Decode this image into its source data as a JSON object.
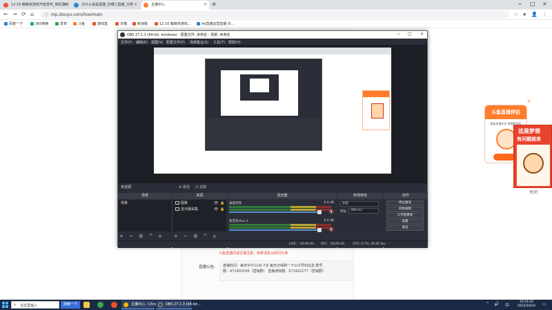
{
  "browser": {
    "tabs": [
      {
        "label": "12.16 蜘蛛侠游戏开放发布_单机游戏",
        "close": "×",
        "color": "#e8532f"
      },
      {
        "label": "为什么说是直播_在哪儿直播_分类",
        "close": "×",
        "color": "#2a84d8"
      },
      {
        "label": "主播中心",
        "close": "×",
        "color": "#ff7d2b"
      }
    ],
    "new_tab": "+",
    "window_controls": [
      "−",
      "□",
      "×"
    ],
    "nav": {
      "back": "←",
      "forward": "→",
      "reload": "⟳",
      "home": "⌂"
    },
    "url": "mp.douyu.com/live/main",
    "lock": "ⓘ",
    "address_right": [
      "☆",
      "★",
      "👤",
      "⋮"
    ],
    "bookmarks": [
      {
        "label": "百度一下",
        "color": "#2a84d8"
      },
      {
        "label": "360搜索",
        "color": "#2aa84d"
      },
      {
        "label": "爱奇",
        "color": "#2aa84d"
      },
      {
        "label": "斗鱼",
        "color": "#ff7d2b"
      },
      {
        "label": "游戏盒",
        "color": "#e8532f"
      },
      {
        "label": "天猫",
        "color": "#e8532f"
      },
      {
        "label": "新浪版",
        "color": "#e8532f"
      },
      {
        "label": "12.16 蜘蛛侠游戏...",
        "color": "#e8532f"
      },
      {
        "label": "Ae直播运营直播 抖...",
        "color": "#2a84d8"
      }
    ]
  },
  "page": {
    "notice": "斗鱼直播间请主播注意，有新消息以时间为准",
    "announce_label": "直播公告:",
    "announce_lines": [
      "直播时间：每天中午12点-7点  每天记得刷一下公众号的信息 群号",
      "群：471903106（营销群）  直播通知群：571922177（营销群）"
    ]
  },
  "promo": {
    "title": "斗鱼直播伴侣",
    "sub": "超级直播伴侣 直播更轻松",
    "close": "×"
  },
  "promo2": {
    "line1": "这是梦想",
    "line2": "有问题就来",
    "close": "关闭"
  },
  "obs": {
    "title": "OBS 27.1.3 (64-bit, windows) - 配置文件: 未命名 - 场景: 未命名",
    "window_controls": [
      "−",
      "□",
      "×"
    ],
    "menu": [
      "文件(F)",
      "编辑(E)",
      "视图(V)",
      "配置文件(P)",
      "场景集合(S)",
      "工具(T)",
      "帮助(H)"
    ],
    "current_scene": "未选源",
    "scene_buttons": [
      "⚙ 属性",
      "☷ 滤镜"
    ],
    "docks": {
      "scenes": "场景",
      "sources": "来源",
      "mixer": "混音器",
      "transitions": "转场特效",
      "controls": "控件"
    },
    "scenes": [
      "场景"
    ],
    "sources": [
      {
        "name": "图像",
        "eye": "👁",
        "lock": "🔒"
      },
      {
        "name": "显示器采集",
        "eye": "👁",
        "lock": "🔒"
      }
    ],
    "mixer": [
      {
        "name": "桌面音频",
        "db": "0.0 dB",
        "mute": "🔇"
      },
      {
        "name": "麦克风/Aux 2",
        "db": "0.0 dB",
        "mute": "🔇"
      }
    ],
    "transition": {
      "type": "淡出",
      "duration_label": "时长",
      "duration": "300 ms"
    },
    "controls": [
      "停止推流",
      "开始录制",
      "工作室模式",
      "设置",
      "退出"
    ],
    "tools": "+ − ⚙ ^ v",
    "status": {
      "live": "LIVE:",
      "live_time": "00:00:00",
      "rec": "REC:",
      "rec_time": "00:00:00",
      "cpu": "CPU: 0.7%, 30.00 fps"
    }
  },
  "taskbar": {
    "search_text": "在这里输入",
    "button": "搜索一下",
    "apps": [
      {
        "label": "主播中心 - Chrome",
        "color": "#f4b400"
      },
      {
        "label": "OBS 27.1.3 (64-bit...",
        "color": "#444"
      }
    ],
    "tray": [
      "^",
      "🔊",
      "中"
    ],
    "time": "10:31:42",
    "date": "2022/10/24"
  }
}
